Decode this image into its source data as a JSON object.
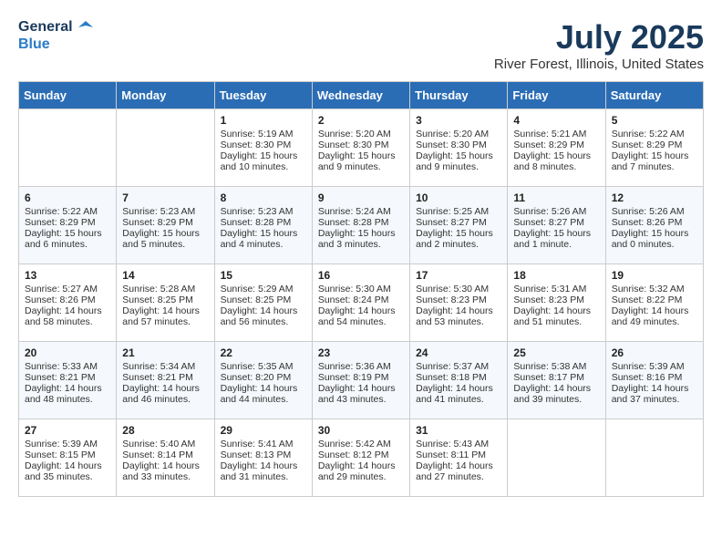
{
  "header": {
    "logo_line1": "General",
    "logo_line2": "Blue",
    "month_title": "July 2025",
    "location": "River Forest, Illinois, United States"
  },
  "days_of_week": [
    "Sunday",
    "Monday",
    "Tuesday",
    "Wednesday",
    "Thursday",
    "Friday",
    "Saturday"
  ],
  "weeks": [
    [
      {
        "day": "",
        "info": ""
      },
      {
        "day": "",
        "info": ""
      },
      {
        "day": "1",
        "info": "Sunrise: 5:19 AM\nSunset: 8:30 PM\nDaylight: 15 hours and 10 minutes."
      },
      {
        "day": "2",
        "info": "Sunrise: 5:20 AM\nSunset: 8:30 PM\nDaylight: 15 hours and 9 minutes."
      },
      {
        "day": "3",
        "info": "Sunrise: 5:20 AM\nSunset: 8:30 PM\nDaylight: 15 hours and 9 minutes."
      },
      {
        "day": "4",
        "info": "Sunrise: 5:21 AM\nSunset: 8:29 PM\nDaylight: 15 hours and 8 minutes."
      },
      {
        "day": "5",
        "info": "Sunrise: 5:22 AM\nSunset: 8:29 PM\nDaylight: 15 hours and 7 minutes."
      }
    ],
    [
      {
        "day": "6",
        "info": "Sunrise: 5:22 AM\nSunset: 8:29 PM\nDaylight: 15 hours and 6 minutes."
      },
      {
        "day": "7",
        "info": "Sunrise: 5:23 AM\nSunset: 8:29 PM\nDaylight: 15 hours and 5 minutes."
      },
      {
        "day": "8",
        "info": "Sunrise: 5:23 AM\nSunset: 8:28 PM\nDaylight: 15 hours and 4 minutes."
      },
      {
        "day": "9",
        "info": "Sunrise: 5:24 AM\nSunset: 8:28 PM\nDaylight: 15 hours and 3 minutes."
      },
      {
        "day": "10",
        "info": "Sunrise: 5:25 AM\nSunset: 8:27 PM\nDaylight: 15 hours and 2 minutes."
      },
      {
        "day": "11",
        "info": "Sunrise: 5:26 AM\nSunset: 8:27 PM\nDaylight: 15 hours and 1 minute."
      },
      {
        "day": "12",
        "info": "Sunrise: 5:26 AM\nSunset: 8:26 PM\nDaylight: 15 hours and 0 minutes."
      }
    ],
    [
      {
        "day": "13",
        "info": "Sunrise: 5:27 AM\nSunset: 8:26 PM\nDaylight: 14 hours and 58 minutes."
      },
      {
        "day": "14",
        "info": "Sunrise: 5:28 AM\nSunset: 8:25 PM\nDaylight: 14 hours and 57 minutes."
      },
      {
        "day": "15",
        "info": "Sunrise: 5:29 AM\nSunset: 8:25 PM\nDaylight: 14 hours and 56 minutes."
      },
      {
        "day": "16",
        "info": "Sunrise: 5:30 AM\nSunset: 8:24 PM\nDaylight: 14 hours and 54 minutes."
      },
      {
        "day": "17",
        "info": "Sunrise: 5:30 AM\nSunset: 8:23 PM\nDaylight: 14 hours and 53 minutes."
      },
      {
        "day": "18",
        "info": "Sunrise: 5:31 AM\nSunset: 8:23 PM\nDaylight: 14 hours and 51 minutes."
      },
      {
        "day": "19",
        "info": "Sunrise: 5:32 AM\nSunset: 8:22 PM\nDaylight: 14 hours and 49 minutes."
      }
    ],
    [
      {
        "day": "20",
        "info": "Sunrise: 5:33 AM\nSunset: 8:21 PM\nDaylight: 14 hours and 48 minutes."
      },
      {
        "day": "21",
        "info": "Sunrise: 5:34 AM\nSunset: 8:21 PM\nDaylight: 14 hours and 46 minutes."
      },
      {
        "day": "22",
        "info": "Sunrise: 5:35 AM\nSunset: 8:20 PM\nDaylight: 14 hours and 44 minutes."
      },
      {
        "day": "23",
        "info": "Sunrise: 5:36 AM\nSunset: 8:19 PM\nDaylight: 14 hours and 43 minutes."
      },
      {
        "day": "24",
        "info": "Sunrise: 5:37 AM\nSunset: 8:18 PM\nDaylight: 14 hours and 41 minutes."
      },
      {
        "day": "25",
        "info": "Sunrise: 5:38 AM\nSunset: 8:17 PM\nDaylight: 14 hours and 39 minutes."
      },
      {
        "day": "26",
        "info": "Sunrise: 5:39 AM\nSunset: 8:16 PM\nDaylight: 14 hours and 37 minutes."
      }
    ],
    [
      {
        "day": "27",
        "info": "Sunrise: 5:39 AM\nSunset: 8:15 PM\nDaylight: 14 hours and 35 minutes."
      },
      {
        "day": "28",
        "info": "Sunrise: 5:40 AM\nSunset: 8:14 PM\nDaylight: 14 hours and 33 minutes."
      },
      {
        "day": "29",
        "info": "Sunrise: 5:41 AM\nSunset: 8:13 PM\nDaylight: 14 hours and 31 minutes."
      },
      {
        "day": "30",
        "info": "Sunrise: 5:42 AM\nSunset: 8:12 PM\nDaylight: 14 hours and 29 minutes."
      },
      {
        "day": "31",
        "info": "Sunrise: 5:43 AM\nSunset: 8:11 PM\nDaylight: 14 hours and 27 minutes."
      },
      {
        "day": "",
        "info": ""
      },
      {
        "day": "",
        "info": ""
      }
    ]
  ]
}
